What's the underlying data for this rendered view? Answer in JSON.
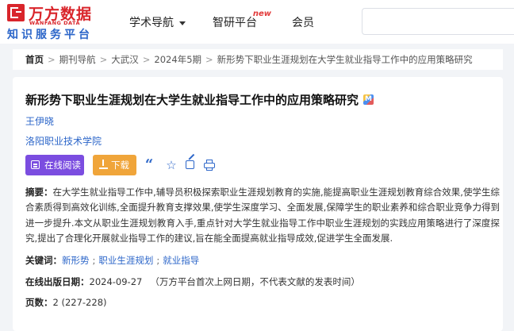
{
  "header": {
    "logo_cn": "万方数据",
    "logo_en": "WANFANG DATA",
    "logo_sub": "知识服务平台",
    "nav": {
      "academic": "学术导航",
      "research": "智研平台",
      "research_badge": "new",
      "member": "会员"
    }
  },
  "breadcrumb": {
    "items": [
      "首页",
      "期刊导航",
      "大武汉",
      "2024年5期",
      "新形势下职业生涯规划在大学生就业指导工作中的应用策略研究"
    ],
    "separator": ">"
  },
  "article": {
    "title": "新形势下职业生涯规划在大学生就业指导工作中的应用策略研究",
    "author": "王伊晓",
    "organization": "洛阳职业技术学院",
    "buttons": {
      "read_online": "在线阅读",
      "download": "下载"
    },
    "abstract_label": "摘要：",
    "abstract": "在大学生就业指导工作中,辅导员积极探索职业生涯规划教育的实施,能提高职业生涯规划教育综合效果,使学生综合素质得到高效化训练,全面提升教育支撑效果,使学生深度学习、全面发展,保障学生的职业素养和综合职业竞争力得到进一步提升.本文从职业生涯规划教育入手,重点针对大学生就业指导工作中职业生涯规划的实践应用策略进行了深度探究,提出了合理化开展就业指导工作的建议,旨在能全面提高就业指导成效,促进学生全面发展.",
    "keywords_label": "关键词：",
    "keywords": [
      "新形势",
      "职业生涯规划",
      "就业指导"
    ],
    "keyword_sep": ";",
    "pubdate_label": "在线出版日期：",
    "pubdate": "2024-09-27",
    "pubdate_note": "（万方平台首次上网日期，不代表文献的发表时间）",
    "pages_label": "页数：",
    "pages": "2 (227-228)"
  }
}
